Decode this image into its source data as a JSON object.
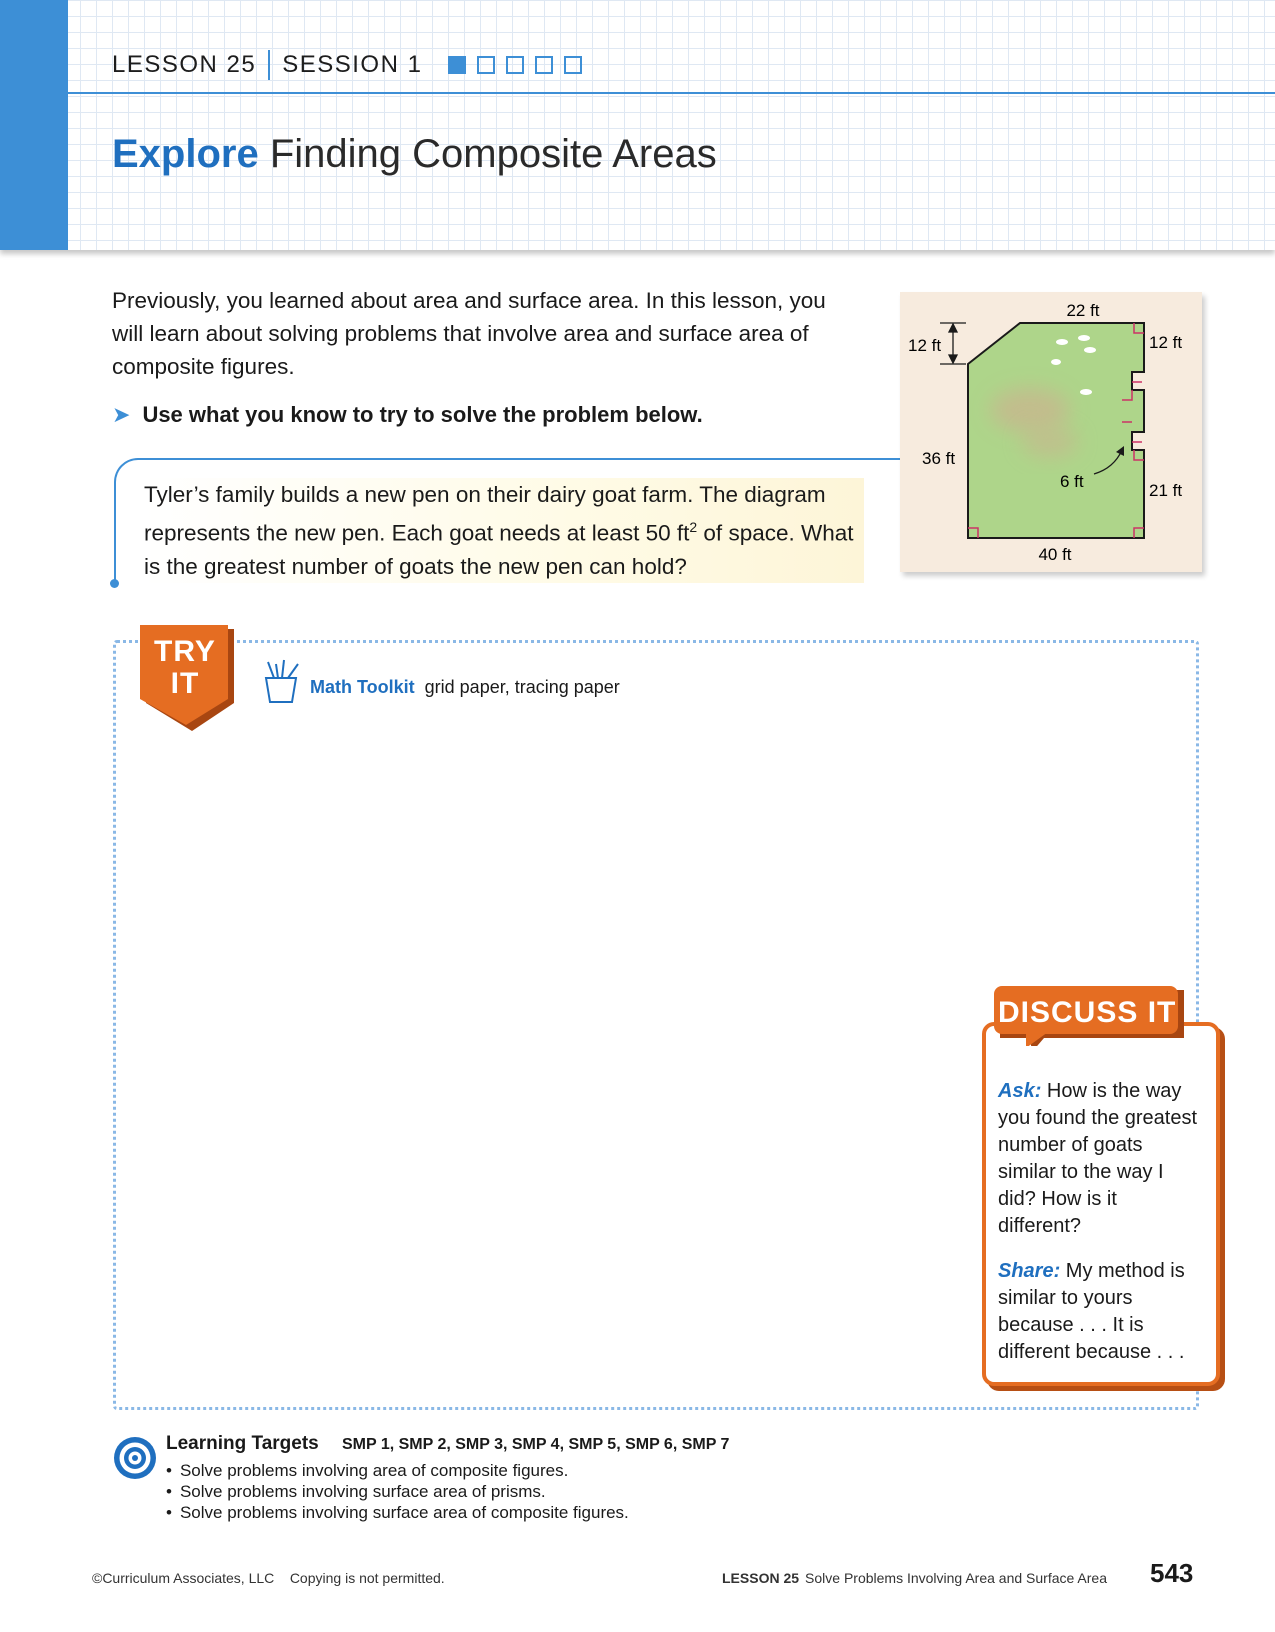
{
  "header": {
    "lesson": "LESSON 25",
    "session": "SESSION 1",
    "title_emph": "Explore",
    "title_rest": " Finding Composite Areas",
    "progress_total": 5,
    "progress_current": 1
  },
  "intro": "Previously, you learned about area and surface area. In this lesson, you will learn about solving problems that involve area and surface area of composite figures.",
  "prompt": "Use what you know to try to solve the problem below.",
  "problem": {
    "part1": "Tyler’s family builds a new pen on their dairy goat farm. The diagram represents the new pen. Each goat needs at least 50 ft",
    "exponent": "2",
    "part2": " of space. What is the greatest number of goats the new pen can hold?"
  },
  "diagram": {
    "labels": {
      "top": "22 ft",
      "left_small": "12 ft",
      "right_top": "12 ft",
      "left": "36 ft",
      "notch": "6 ft",
      "right_bottom": "21 ft",
      "bottom": "40 ft"
    },
    "colors": {
      "field": "#aed58a",
      "outline": "#1a1a1a",
      "right_angle": "#cc3366"
    }
  },
  "try_it": {
    "badge_line1": "TRY",
    "badge_line2": "IT",
    "toolkit_label": "Math Toolkit",
    "toolkit_items": "grid paper, tracing paper"
  },
  "discuss": {
    "title": "DISCUSS IT",
    "ask_label": "Ask:",
    "ask_text": " How is the way you found the greatest number of goats similar to the way I did? How is it different?",
    "share_label": "Share:",
    "share_text": " My method is similar to yours because . . . It is different because . . ."
  },
  "learning_targets": {
    "title": "Learning Targets",
    "smp": "SMP 1, SMP 2, SMP 3, SMP 4, SMP 5, SMP 6, SMP 7",
    "items": [
      "Solve problems involving area of composite figures.",
      "Solve problems involving surface area of prisms.",
      "Solve problems involving surface area of composite figures."
    ]
  },
  "footer": {
    "copyright": "©Curriculum Associates, LLC    Copying is not permitted.",
    "lesson": "LESSON 25",
    "lesson_title": "Solve Problems Involving Area and Surface Area",
    "page": "543"
  },
  "colors": {
    "accent_blue": "#3d8fd6",
    "title_blue": "#1f6fbf",
    "orange": "#e56d22"
  }
}
